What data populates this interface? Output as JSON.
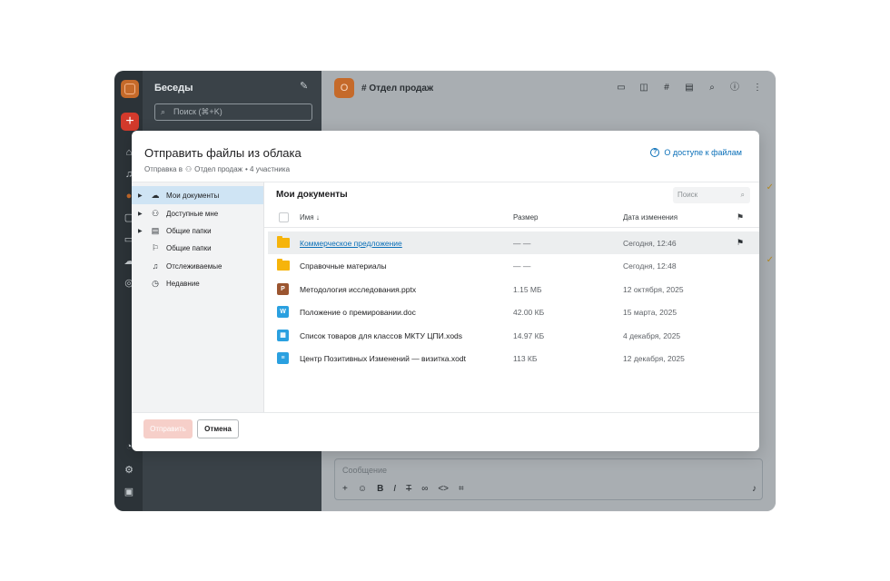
{
  "app": {
    "sidebar_title": "Беседы",
    "search_placeholder": "Поиск (⌘+K)",
    "channel_avatar_letter": "О",
    "channel_name": "Отдел продаж",
    "composer_placeholder": "Сообщение"
  },
  "dialog": {
    "title": "Отправить файлы из облака",
    "subtitle_prefix": "Отправка в",
    "subtitle_target": "Отдел продаж",
    "subtitle_members": "• 4 участника",
    "access_link": "О доступе к файлам",
    "tree": [
      {
        "label": "Мои документы",
        "icon": "cloud-icon",
        "expandable": true,
        "selected": true
      },
      {
        "label": "Доступные мне",
        "icon": "users-icon",
        "expandable": true,
        "selected": false
      },
      {
        "label": "Общие папки",
        "icon": "briefcase-icon",
        "expandable": true,
        "selected": false
      },
      {
        "label": "Общие папки",
        "icon": "flag-icon",
        "expandable": false,
        "selected": false
      },
      {
        "label": "Отслеживаемые",
        "icon": "bell-icon",
        "expandable": false,
        "selected": false
      },
      {
        "label": "Недавние",
        "icon": "clock-icon",
        "expandable": false,
        "selected": false
      }
    ],
    "files_title": "Мои документы",
    "files_search_placeholder": "Поиск",
    "columns": {
      "name": "Имя",
      "size": "Размер",
      "date": "Дата изменения"
    },
    "rows": [
      {
        "name": "Коммерческое предложение",
        "type": "folder",
        "size": "— —",
        "date": "Сегодня, 12:46",
        "flag": true,
        "highlighted": true
      },
      {
        "name": "Справочные материалы",
        "type": "folder",
        "size": "— —",
        "date": "Сегодня, 12:48",
        "flag": false,
        "highlighted": false
      },
      {
        "name": "Методология исследования.pptx",
        "type": "pptx",
        "size": "1.15 МБ",
        "date": "12 октября, 2025",
        "flag": false,
        "highlighted": false
      },
      {
        "name": "Положение о премировании.doc",
        "type": "doc",
        "size": "42.00 КБ",
        "date": "15 марта, 2025",
        "flag": false,
        "highlighted": false
      },
      {
        "name": "Список товаров для классов МКТУ ЦПИ.xods",
        "type": "xods",
        "size": "14.97 КБ",
        "date": "4 декабря, 2025",
        "flag": false,
        "highlighted": false
      },
      {
        "name": "Центр Позитивных Изменений — визитка.xodt",
        "type": "xodt",
        "size": "113 КБ",
        "date": "12 декабря, 2025",
        "flag": false,
        "highlighted": false
      }
    ],
    "send_label": "Отправить",
    "cancel_label": "Отмена"
  },
  "colors": {
    "accent": "#0a6fb8",
    "brand": "#c56a2a",
    "send_disabled": "#f6cfc9",
    "selected_tree": "#cfe4f4"
  }
}
